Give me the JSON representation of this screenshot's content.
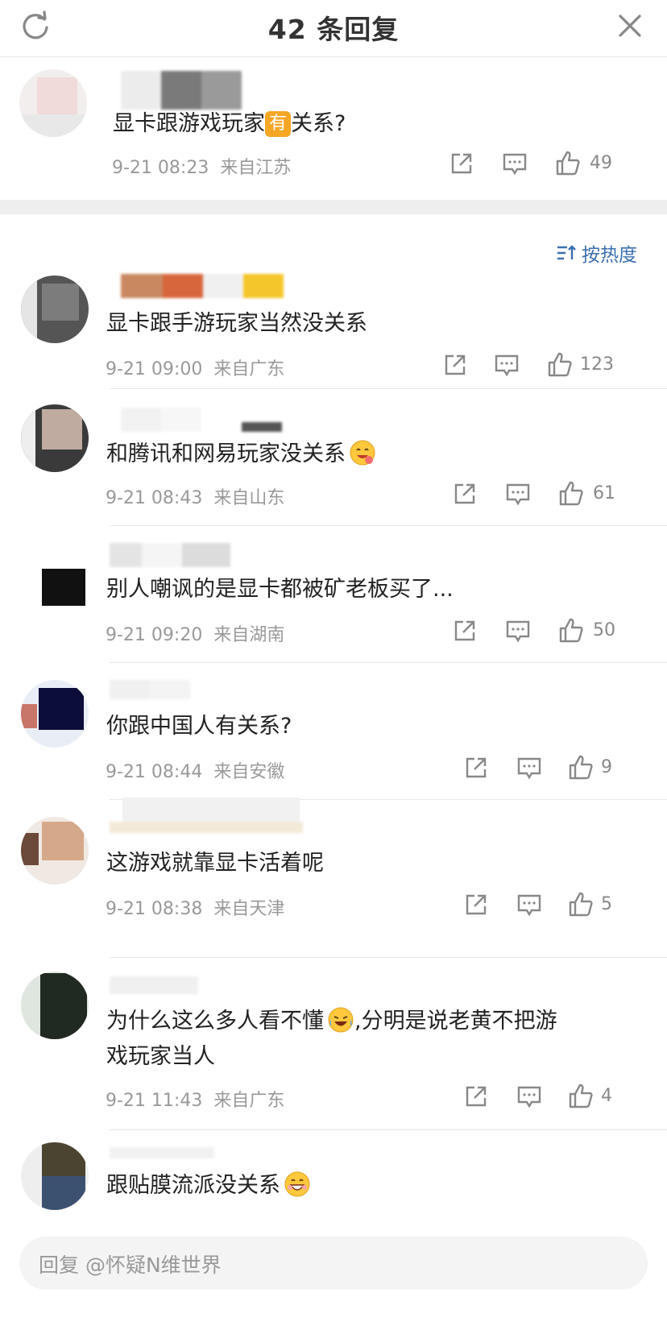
{
  "header": {
    "title": "42 条回复",
    "refresh_icon": "refresh-icon",
    "close_icon": "close-icon"
  },
  "root_comment": {
    "content_before": "显卡跟游戏玩家",
    "content_badge": "有",
    "content_after": "关系?",
    "time": "9-21 08:23",
    "location": "来自江苏",
    "likes": "49"
  },
  "sort": {
    "label": "按热度"
  },
  "replies": [
    {
      "content": "显卡跟手游玩家当然没关系",
      "time": "9-21 09:00",
      "location": "来自广东",
      "likes": "123"
    },
    {
      "content": "和腾讯和网易玩家没关系",
      "emoji": "yum-emoji-icon",
      "time": "9-21 08:43",
      "location": "来自山东",
      "likes": "61"
    },
    {
      "content": "别人嘲讽的是显卡都被矿老板买了...",
      "time": "9-21 09:20",
      "location": "来自湖南",
      "likes": "50"
    },
    {
      "content": "你跟中国人有关系?",
      "time": "9-21 08:44",
      "location": "来自安徽",
      "likes": "9"
    },
    {
      "content": "这游戏就靠显卡活着呢",
      "time": "9-21 08:38",
      "location": "来自天津",
      "likes": "5"
    },
    {
      "content_line1_a": "为什么这么多人看不懂",
      "emoji": "laugh-cry-emoji-icon",
      "content_line1_b": ",分明是说老黄不把游",
      "content_line2": "戏玩家当人",
      "time": "9-21 11:43",
      "location": "来自广东",
      "likes": "4"
    },
    {
      "content": "跟贴膜流派没关系",
      "emoji": "grin-emoji-icon"
    }
  ],
  "input": {
    "placeholder": "回复 @怀疑N维世界"
  },
  "colors": {
    "accent": "#3b6fb0",
    "meta": "#999999",
    "badge": "#f5a623"
  }
}
